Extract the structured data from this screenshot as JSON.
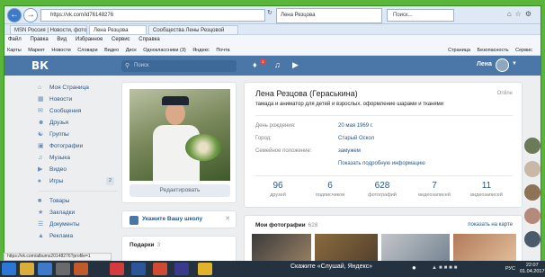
{
  "browser": {
    "url": "https://vk.com/id76148276",
    "tabs": [
      {
        "label": "MSN Россия | Новости, фото..."
      },
      {
        "label": "Лена Резцова"
      },
      {
        "label": "Сообщества Лены Резцовой"
      }
    ],
    "active_tab": "Лена Резцова",
    "search_field": "Поиск...",
    "menu": [
      "Файл",
      "Правка",
      "Вид",
      "Избранное",
      "Сервис",
      "Справка"
    ],
    "favorites": [
      "Карты",
      "Маркет",
      "Новости",
      "Словари",
      "Видео",
      "Диск",
      "Одноклассники (3)",
      "Яндекс",
      "Почта"
    ],
    "favorites_right": [
      "Страница",
      "Безопасность",
      "Сервис"
    ],
    "status_url": "https://vk.com/albums20148276?profile=1"
  },
  "vk": {
    "logo": "ВК",
    "search_placeholder": "Поиск",
    "notif_badge": "1",
    "user_name": "Лена",
    "sidebar": [
      {
        "label": "Моя Страница",
        "icon": "home-icon"
      },
      {
        "label": "Новости",
        "icon": "news-icon"
      },
      {
        "label": "Сообщения",
        "icon": "messages-icon"
      },
      {
        "label": "Друзья",
        "icon": "friends-icon"
      },
      {
        "label": "Группы",
        "icon": "groups-icon"
      },
      {
        "label": "Фотографии",
        "icon": "photos-icon"
      },
      {
        "label": "Музыка",
        "icon": "music-icon"
      },
      {
        "label": "Видео",
        "icon": "video-icon"
      },
      {
        "label": "Игры",
        "icon": "games-icon",
        "count": "2"
      }
    ],
    "sidebar_extra": [
      {
        "label": "Товары",
        "icon": "goods-icon"
      },
      {
        "label": "Закладки",
        "icon": "bookmarks-icon"
      },
      {
        "label": "Документы",
        "icon": "documents-icon"
      },
      {
        "label": "Реклама",
        "icon": "ads-icon"
      }
    ],
    "edit_button": "Редактировать",
    "school_prompt": "Укажите Вашу школу",
    "gifts_title": "Подарки",
    "gifts_count": "3"
  },
  "profile": {
    "name": "Лена Резцова (Гераськина)",
    "online": "Online",
    "status": "тамада и аниматор для детей и взрослых. оформление шарами и тканями",
    "fields": [
      {
        "label": "День рождения:",
        "value": "20 мая 1969 г."
      },
      {
        "label": "Город:",
        "value": "Старый Оскол"
      },
      {
        "label": "Семейное положение:",
        "value": "замужем"
      }
    ],
    "more_link": "Показать подробную информацию",
    "counters": [
      {
        "num": "96",
        "label": "друзей"
      },
      {
        "num": "6",
        "label": "подписчиков"
      },
      {
        "num": "628",
        "label": "фотографий"
      },
      {
        "num": "7",
        "label": "видеозаписей"
      },
      {
        "num": "11",
        "label": "видеозаписей"
      }
    ],
    "photos_title": "Мои фотографии",
    "photos_count": "628",
    "photos_map": "показать на карте"
  },
  "taskbar": {
    "search": "Скажите «Слушай, Яндекс»",
    "lang": "РУС",
    "time": "22:07",
    "date": "01.04.2017"
  },
  "colors": {
    "vk_blue": "#4a76a8",
    "link": "#2a5885",
    "background": "#edeef0",
    "desktop_green": "#5ab63b"
  }
}
